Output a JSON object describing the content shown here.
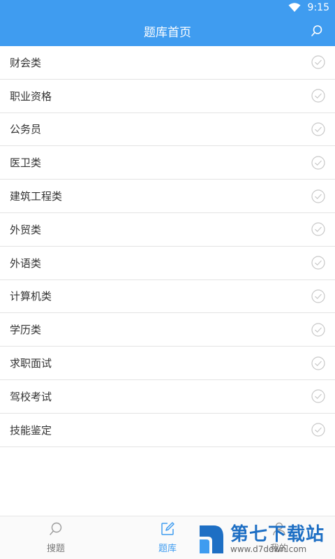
{
  "status_bar": {
    "time": "9:15"
  },
  "header": {
    "title": "题库首页"
  },
  "categories": [
    {
      "label": "财会类"
    },
    {
      "label": "职业资格"
    },
    {
      "label": "公务员"
    },
    {
      "label": "医卫类"
    },
    {
      "label": "建筑工程类"
    },
    {
      "label": "外贸类"
    },
    {
      "label": "外语类"
    },
    {
      "label": "计算机类"
    },
    {
      "label": "学历类"
    },
    {
      "label": "求职面试"
    },
    {
      "label": "驾校考试"
    },
    {
      "label": "技能鉴定"
    }
  ],
  "tabbar": {
    "tabs": [
      {
        "label": "搜题",
        "icon": "search-icon"
      },
      {
        "label": "题库",
        "icon": "edit-icon",
        "active": true
      },
      {
        "label": "我的",
        "icon": "person-icon"
      }
    ]
  },
  "watermark": {
    "title": "第七下载站",
    "url": "www.d7down.com"
  },
  "colors": {
    "primary": "#3f9cf0",
    "divider": "#e3e3e3"
  }
}
